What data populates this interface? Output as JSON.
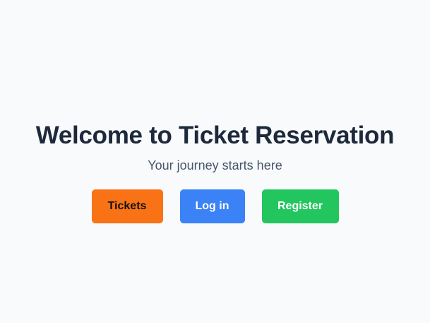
{
  "hero": {
    "title": "Welcome to Ticket Reservation",
    "subtitle": "Your journey starts here"
  },
  "actions": {
    "tickets_label": "Tickets",
    "login_label": "Log in",
    "register_label": "Register"
  },
  "colors": {
    "background": "#f8fafc",
    "title": "#1e293b",
    "subtitle": "#475569",
    "tickets": "#f97316",
    "login": "#3b82f6",
    "register": "#22c55e"
  }
}
